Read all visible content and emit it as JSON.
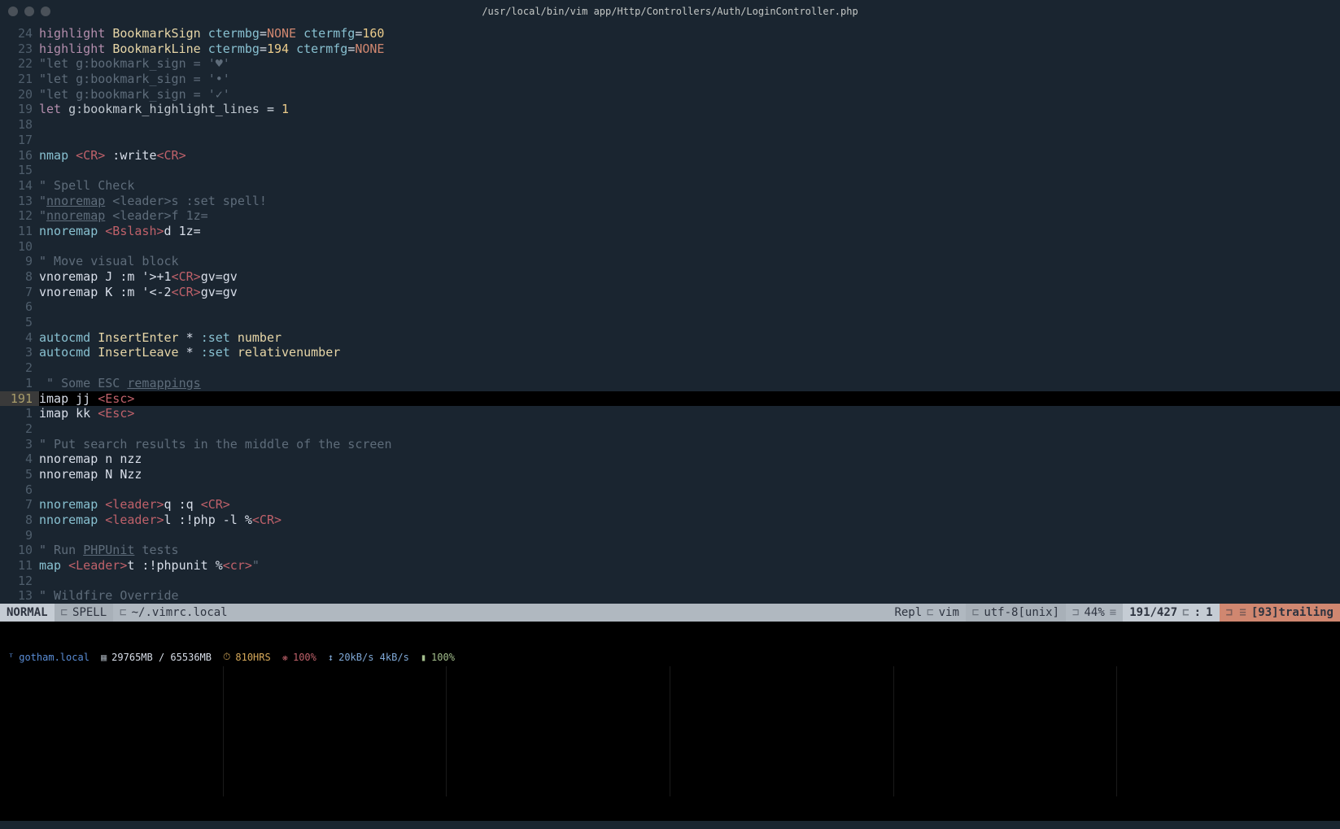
{
  "titlebar": {
    "title": "/usr/local/bin/vim app/Http/Controllers/Auth/LoginController.php"
  },
  "gutter_numbers": [
    "24",
    "23",
    "22",
    "21",
    "20",
    "19",
    "18",
    "17",
    "16",
    "15",
    "14",
    "13",
    "12",
    "11",
    "10",
    "9",
    "8",
    "7",
    "6",
    "5",
    "4",
    "3",
    "2",
    "1",
    "191",
    "1",
    "2",
    "3",
    "4",
    "5",
    "6",
    "7",
    "8",
    "9",
    "10",
    "11",
    "12",
    "13"
  ],
  "code": {
    "l0": {
      "kw": "highlight",
      "id": "BookmarkSign",
      "a1": "ctermbg",
      "eq": "=",
      "v1": "NONE",
      "a2": "ctermfg",
      "v2": "160"
    },
    "l1": {
      "kw": "highlight",
      "id": "BookmarkLine",
      "a1": "ctermbg",
      "eq": "=",
      "v1": "194",
      "a2": "ctermfg",
      "v2": "NONE"
    },
    "l2": {
      "txt": "\"let g:bookmark_sign = '♥'"
    },
    "l3": {
      "txt": "\"let g:bookmark_sign = '•'"
    },
    "l4": {
      "txt": "\"let g:bookmark_sign = '✓'"
    },
    "l5": {
      "kw": "let",
      "var": "g:bookmark_highlight_lines",
      "eq": " = ",
      "val": "1"
    },
    "l8": {
      "kw": "nmap",
      "cr1": "<CR>",
      "mid": " :write",
      "cr2": "<CR>"
    },
    "l10": {
      "q": "\"",
      "txt": " Spell Check"
    },
    "l11": {
      "q": "\"",
      "map": "nnoremap",
      "arg": " <leader>s :set spell!"
    },
    "l12": {
      "q": "\"",
      "map": "nnoremap",
      "arg": " <leader>f 1z="
    },
    "l13": {
      "map": "nnoremap ",
      "bs": "<Bslash>",
      "rest": "d 1z="
    },
    "l15": {
      "q": "\"",
      "txt": " Move visual block"
    },
    "l16": {
      "map": "vnoremap J :m '>+1",
      "cr": "<CR>",
      "rest": "gv=gv"
    },
    "l17": {
      "map": "vnoremap K :m '<-2",
      "cr": "<CR>",
      "rest": "gv=gv"
    },
    "l20": {
      "kw": "autocmd",
      "ev": "InsertEnter",
      "star": "*",
      "set": ":set",
      "opt": "number"
    },
    "l21": {
      "kw": "autocmd",
      "ev": "InsertLeave",
      "star": "*",
      "set": ":set",
      "opt": "relativenumber"
    },
    "l23": {
      "txt": " \" Some ESC ",
      "rem": "remappings"
    },
    "l24": {
      "map": "imap jj ",
      "esc": "<Esc>"
    },
    "l25": {
      "map": "imap kk ",
      "esc": "<Esc>"
    },
    "l27": {
      "q": "\"",
      "txt": " Put search results in the middle of the screen"
    },
    "l28": {
      "map": "nnoremap n nzz"
    },
    "l29": {
      "map": "nnoremap N Nzz"
    },
    "l31": {
      "map": "nnoremap ",
      "ld": "<leader>",
      "k": "q :q ",
      "cr": "<CR>"
    },
    "l32": {
      "map": "nnoremap ",
      "ld": "<leader>",
      "k": "l :!php -l %",
      "cr": "<CR>"
    },
    "l34": {
      "q": "\"",
      "txt": " Run ",
      "u": "PHPUnit",
      "txt2": " tests"
    },
    "l35": {
      "map": "map ",
      "ld": "<Leader>",
      "k": "t :!phpunit %",
      "cr": "<cr>",
      "q": "\""
    },
    "l37": {
      "q": "\"",
      "txt": " Wildfire Override"
    }
  },
  "status": {
    "mode": "NORMAL",
    "spell": "SPELL",
    "file": "~/.vimrc.local",
    "repl": "Repl",
    "ft": "vim",
    "enc": "utf-8[unix]",
    "pct": "44%",
    "pos": "191/427",
    "col_label": ":",
    "col": "1",
    "trail": "[93]trailing"
  },
  "system": {
    "host": "gotham.local",
    "mem": "29765MB / 65536MB",
    "hrs": "810HRS",
    "cpu": "100%",
    "net": "20kB/s 4kB/s",
    "bat": "100%"
  }
}
